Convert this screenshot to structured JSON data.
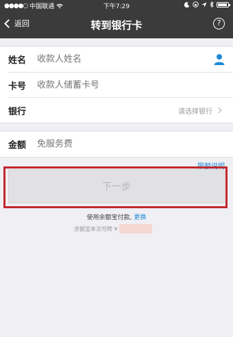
{
  "status_bar": {
    "signal": "●●●●○",
    "carrier": "中国联通",
    "wifi_icon": "wifi-icon",
    "time": "下午7:29",
    "icons": [
      "moon-icon",
      "lock-rotation-icon",
      "location-icon",
      "bluetooth-icon",
      "battery-icon"
    ]
  },
  "nav": {
    "back_label": "返回",
    "title": "转到银行卡",
    "help_label": "?"
  },
  "form": {
    "name": {
      "label": "姓名",
      "placeholder": "收款人姓名",
      "value": ""
    },
    "card": {
      "label": "卡号",
      "placeholder": "收款人储蓄卡号",
      "value": ""
    },
    "bank": {
      "label": "银行",
      "select_text": "请选择银行"
    },
    "amount": {
      "label": "金额",
      "placeholder": "免服务费",
      "value": ""
    }
  },
  "limit_link": "限额说明",
  "next_button": "下一步",
  "payment": {
    "text": "使用余额宝付款,",
    "change_link": "更换",
    "balance_text": "余额宝本次可转 ¥"
  },
  "colors": {
    "bar_bg": "#3b3b3b",
    "accent_blue": "#1e8ad6",
    "highlight_red": "#c2272d"
  }
}
